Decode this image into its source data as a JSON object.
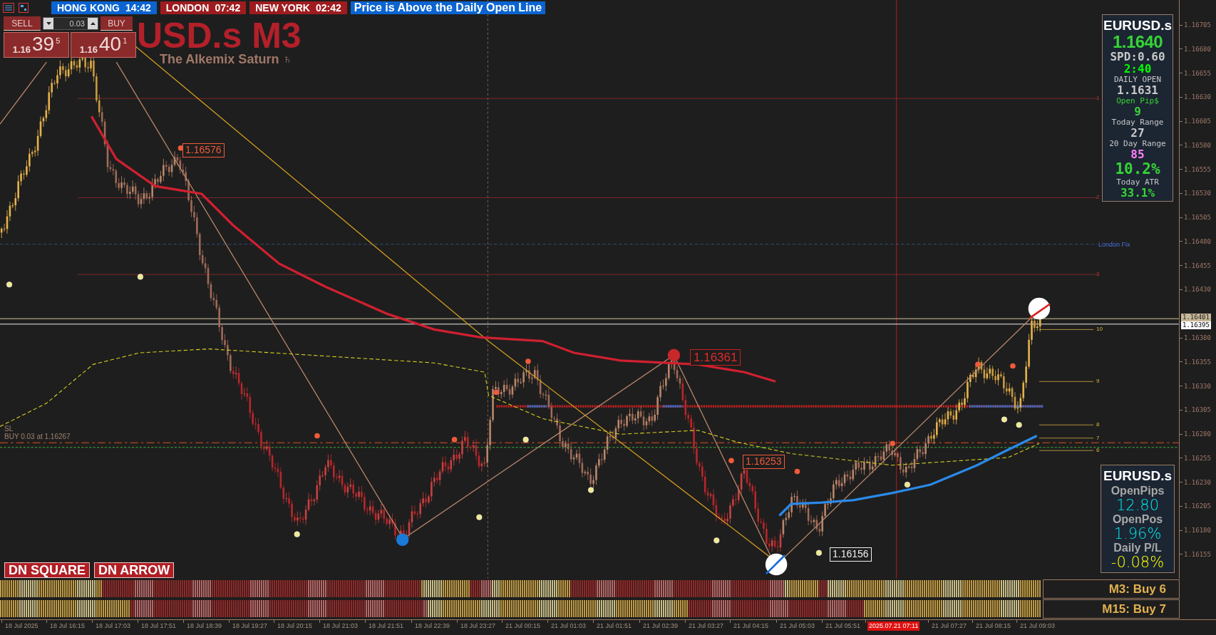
{
  "session_bar": {
    "clocks": [
      {
        "city": "HONG KONG",
        "time": "14:42",
        "color": "#0b64d0"
      },
      {
        "city": "LONDON",
        "time": "07:42",
        "color": "#9e1c1f"
      },
      {
        "city": "NEW YORK",
        "time": "02:42",
        "color": "#9e1c1f"
      }
    ],
    "alert": "Price is Above the Daily Open Line"
  },
  "trade_panel": {
    "sell_label": "SELL",
    "buy_label": "BUY",
    "lot": "0.03",
    "sell_price": {
      "big": "1.16",
      "pips": "39",
      "fraction": "5"
    },
    "buy_price": {
      "big": "1.16",
      "pips": "40",
      "fraction": "1"
    }
  },
  "chart_title": "USD.s M3",
  "chart_subtitle": "The Alkemix Saturn ♄",
  "price_labels": [
    {
      "text": "1.16576",
      "kind": "high"
    },
    {
      "text": "1.16361",
      "kind": "major"
    },
    {
      "text": "1.16253",
      "kind": "high"
    },
    {
      "text": "1.16156",
      "kind": "low"
    }
  ],
  "order_line": {
    "sl": "SL",
    "text": "BUY 0.03 at 1.16267"
  },
  "london_fix": "London Fix",
  "level_marks": [
    "1",
    "2",
    "3",
    "10",
    "9",
    "8",
    "7",
    "6"
  ],
  "info_panel": {
    "symbol": "EURUSD.s",
    "rows": [
      {
        "text": "1.1640",
        "kind": "price",
        "color": "#35d435"
      },
      {
        "text": "SPD:0.60",
        "kind": "value",
        "color": "#c8c8c8"
      },
      {
        "text": "2:40",
        "kind": "value",
        "color": "#00ff00"
      },
      {
        "text": "DAILY OPEN",
        "kind": "label",
        "color": "#c8c8c8"
      },
      {
        "text": "1.1631",
        "kind": "value",
        "color": "#c8c8c8"
      },
      {
        "text": "Open Pip$",
        "kind": "label",
        "color": "#35d435"
      },
      {
        "text": "9",
        "kind": "value",
        "color": "#35d435"
      },
      {
        "text": "Today Range",
        "kind": "label",
        "color": "#c8c8c8"
      },
      {
        "text": "27",
        "kind": "value",
        "color": "#c8c8c8"
      },
      {
        "text": "20 Day Range",
        "kind": "label",
        "color": "#c8c8c8"
      },
      {
        "text": "85",
        "kind": "value",
        "color": "#ff80ff"
      },
      {
        "text": "10.2%",
        "kind": "big",
        "color": "#35d435"
      },
      {
        "text": "Today ATR",
        "kind": "label",
        "color": "#c8c8c8"
      },
      {
        "text": "33.1%",
        "kind": "value",
        "color": "#35d435"
      }
    ]
  },
  "account_panel": {
    "symbol": "EURUSD.s",
    "rows": [
      {
        "text": "OpenPips",
        "kind": "label",
        "color": "#a8a8a8"
      },
      {
        "text": "12.80",
        "kind": "value",
        "color": "#00e8f0"
      },
      {
        "text": "OpenPos",
        "kind": "label",
        "color": "#a8a8a8"
      },
      {
        "text": "1.96%",
        "kind": "value",
        "color": "#00e8f0"
      },
      {
        "text": "Daily P/L",
        "kind": "label",
        "color": "#a8a8a8"
      },
      {
        "text": "-0.08%",
        "kind": "value",
        "color": "#ffff00"
      }
    ]
  },
  "signal_buttons": [
    "DN SQUARE",
    "DN ARROW"
  ],
  "strength_rows": [
    {
      "label": "M3: Buy 6"
    },
    {
      "label": "M15: Buy 7"
    }
  ],
  "price_axis": {
    "ticks": [
      "1.16705",
      "1.16680",
      "1.16655",
      "1.16630",
      "1.16605",
      "1.16580",
      "1.16555",
      "1.16530",
      "1.16505",
      "1.16480",
      "1.16455",
      "1.16430",
      "1.16380",
      "1.16355",
      "1.16330",
      "1.16305",
      "1.16280",
      "1.16255",
      "1.16230",
      "1.16205",
      "1.16180",
      "1.16155"
    ],
    "current_ask": "1.16401",
    "current_bid": "1.16395"
  },
  "time_axis": {
    "labels": [
      {
        "text": "18 Jul 2025",
        "highlighted": false
      },
      {
        "text": "18 Jul 16:15",
        "highlighted": false
      },
      {
        "text": "18 Jul 17:03",
        "highlighted": false
      },
      {
        "text": "18 Jul 17:51",
        "highlighted": false
      },
      {
        "text": "18 Jul 18:39",
        "highlighted": false
      },
      {
        "text": "18 Jul 19:27",
        "highlighted": false
      },
      {
        "text": "18 Jul 20:15",
        "highlighted": false
      },
      {
        "text": "18 Jul 21:03",
        "highlighted": false
      },
      {
        "text": "18 Jul 21:51",
        "highlighted": false
      },
      {
        "text": "18 Jul 22:39",
        "highlighted": false
      },
      {
        "text": "18 Jul 23:27",
        "highlighted": false
      },
      {
        "text": "21 Jul 00:15",
        "highlighted": false
      },
      {
        "text": "21 Jul 01:03",
        "highlighted": false
      },
      {
        "text": "21 Jul 01:51",
        "highlighted": false
      },
      {
        "text": "21 Jul 02:39",
        "highlighted": false
      },
      {
        "text": "21 Jul 03:27",
        "highlighted": false
      },
      {
        "text": "21 Jul 04:15",
        "highlighted": false
      },
      {
        "text": "21 Jul 05:03",
        "highlighted": false
      },
      {
        "text": "21 Jul 05:51",
        "highlighted": false
      },
      {
        "text": "2025.07.21 07:11",
        "highlighted": true
      },
      {
        "text": "21 Jul 07:27",
        "highlighted": false
      },
      {
        "text": "21 Jul 08:15",
        "highlighted": false
      },
      {
        "text": "21 Jul 09:03",
        "highlighted": false
      }
    ]
  }
}
